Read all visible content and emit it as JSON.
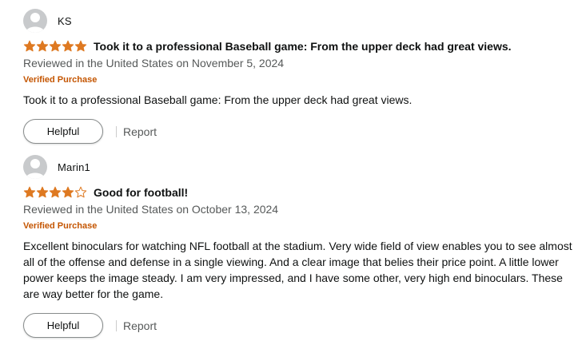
{
  "colors": {
    "star_fill": "#de7921",
    "verified": "#c45500",
    "meta_text": "#565959"
  },
  "reviews": [
    {
      "author": "KS",
      "rating": 5,
      "title": "Took it to a professional Baseball game: From the upper deck had great views.",
      "reviewed": "Reviewed in the United States on November 5, 2024",
      "verified": "Verified Purchase",
      "body": "Took it to a professional Baseball game: From the upper deck had great views.",
      "helpful_label": "Helpful",
      "report_label": "Report"
    },
    {
      "author": "Marin1",
      "rating": 4,
      "title": "Good for football!",
      "reviewed": "Reviewed in the United States on October 13, 2024",
      "verified": "Verified Purchase",
      "body": "Excellent binoculars for watching NFL football at the stadium. Very wide field of view enables you to see almost all of the offense and defense in a single viewing. And a clear image that belies their price point. A little lower power keeps the image steady. I am very impressed, and I have some other, very high end binoculars. These are way better for the game.",
      "helpful_label": "Helpful",
      "report_label": "Report"
    }
  ]
}
